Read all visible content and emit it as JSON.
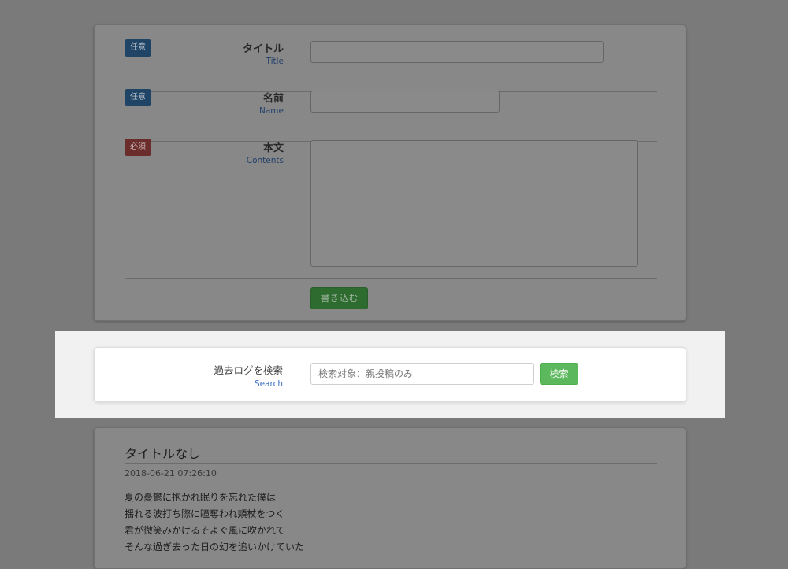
{
  "form": {
    "fields": [
      {
        "badge": "任意",
        "label": "タイトル",
        "sublabel": "Title",
        "value": ""
      },
      {
        "badge": "任意",
        "label": "名前",
        "sublabel": "Name",
        "value": ""
      },
      {
        "badge": "必須",
        "label": "本文",
        "sublabel": "Contents",
        "value": ""
      }
    ],
    "submit_label": "書き込む"
  },
  "search": {
    "label": "過去ログを検索",
    "sublabel": "Search",
    "placeholder": "検索対象：親投稿のみ",
    "button_label": "検索"
  },
  "post": {
    "title": "タイトルなし",
    "date": "2018-06-21 07:26:10",
    "lines": [
      "夏の憂鬱に抱かれ眠りを忘れた僕は",
      "揺れる波打ち際に瞳奪われ頬杖をつく",
      "君が微笑みかけるそよぐ風に吹かれて",
      "そんな過ぎ去った日の幻を追いかけていた"
    ]
  },
  "colors": {
    "overlay": "#7a7a7a",
    "highlight_band": "#f1f1f1",
    "search_button": "#5cb85c",
    "link_blue": "#3b6fc4",
    "optional_badge": "#337ab7",
    "required_badge": "#d9534f"
  }
}
